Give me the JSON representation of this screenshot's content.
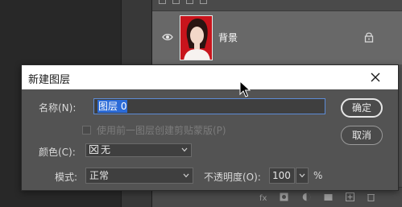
{
  "layers_panel": {
    "layer": {
      "name": "背景"
    }
  },
  "dialog": {
    "title": "新建图层",
    "name_label": "名称(N):",
    "name_value": "图层 0",
    "clipping_label": "使用前一图层创建剪贴蒙版(P)",
    "color_label": "颜色(C):",
    "color_value": "无",
    "mode_label": "模式:",
    "mode_value": "正常",
    "opacity_label": "不透明度(O):",
    "opacity_value": "100",
    "opacity_unit": "%",
    "ok_label": "确定",
    "cancel_label": "取消"
  },
  "colors": {
    "panel_bg": "#535353",
    "selection_blue": "#2b6bd8",
    "layer_thumb_bg": "#c8141c"
  },
  "icons": [
    "eye-icon",
    "lock-icon",
    "close-icon",
    "chevron-down-icon",
    "mouse-cursor"
  ]
}
